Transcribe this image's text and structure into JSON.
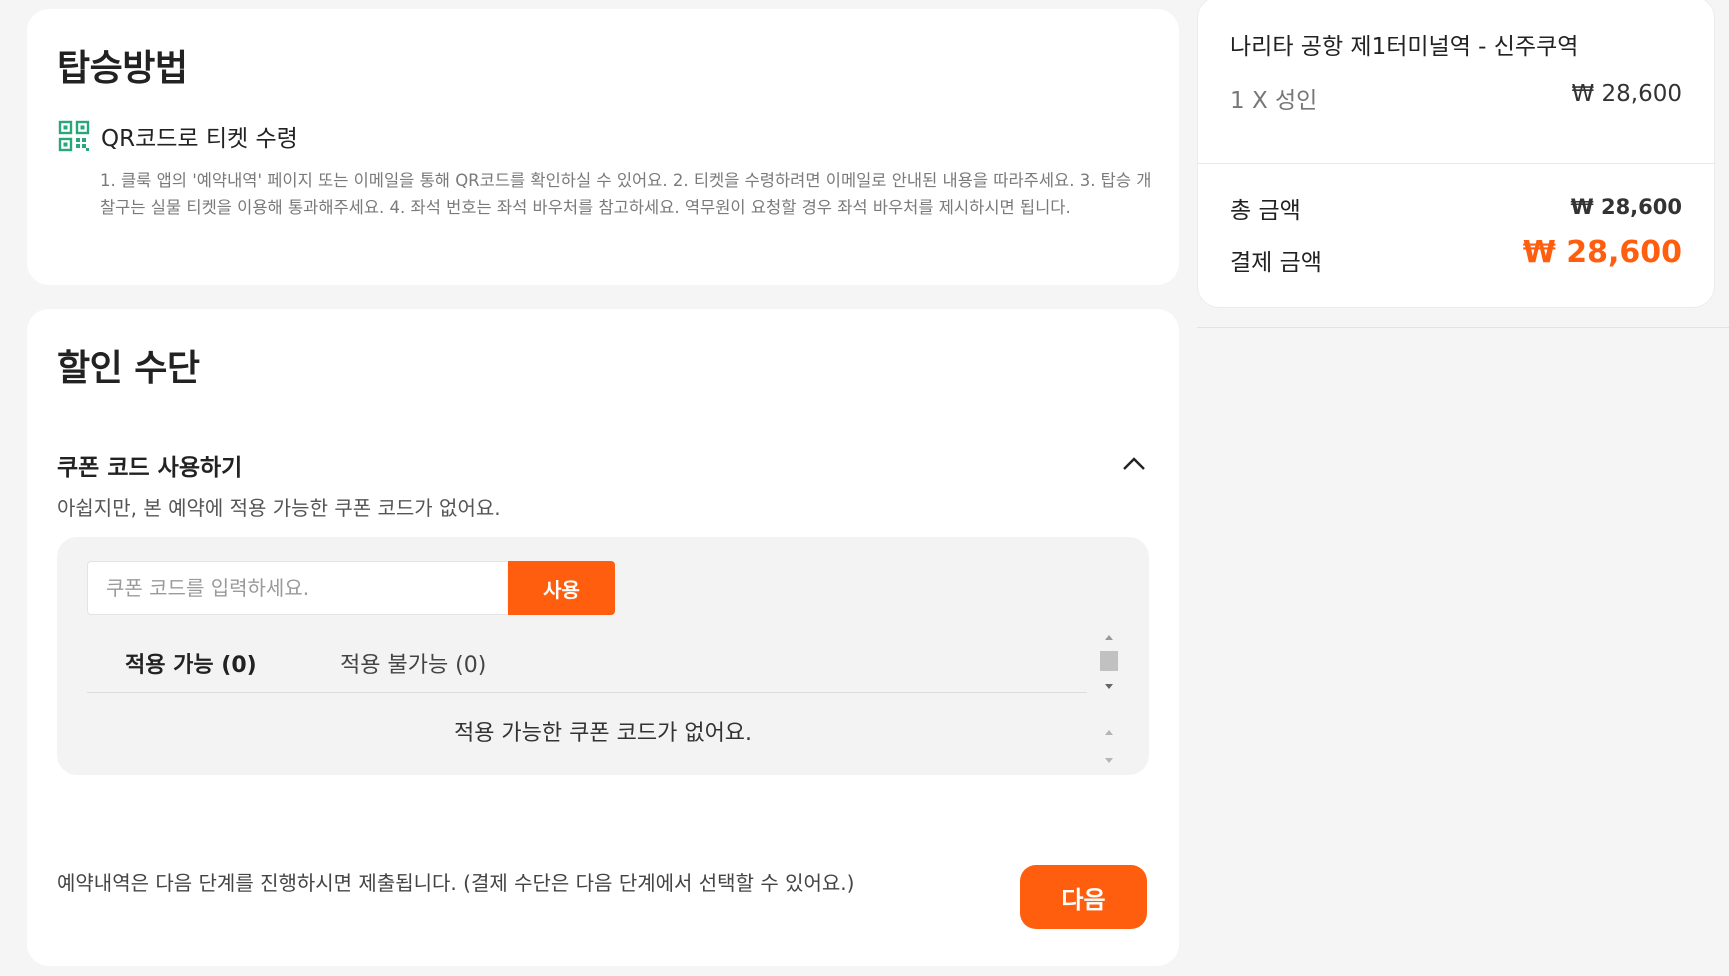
{
  "boarding": {
    "title": "탑승방법",
    "method_icon": "qr-code-icon",
    "method_label": "QR코드로 티켓 수령",
    "guide_text": "1. 클룩 앱의 '예약내역' 페이지 또는 이메일을 통해 QR코드를 확인하실 수 있어요. 2. 티켓을 수령하려면 이메일로 안내된 내용을 따라주세요. 3. 탑승 개찰구는 실물 티켓을 이용해 통과해주세요. 4. 좌석 번호는 좌석 바우처를 참고하세요. 역무원이 요청할 경우 좌석 바우처를 제시하시면 됩니다."
  },
  "discount": {
    "title": "할인 수단",
    "coupon_title": "쿠폰 코드 사용하기",
    "coupon_subtitle": "아쉽지만, 본 예약에 적용 가능한 쿠폰 코드가 없어요.",
    "collapse_icon": "chevron-up-icon",
    "input_placeholder": "쿠폰 코드를 입력하세요.",
    "use_button": "사용",
    "tabs": [
      {
        "label": "적용 가능 (0)"
      },
      {
        "label": "적용 불가능 (0)"
      }
    ],
    "empty_message": "적용 가능한 쿠폰 코드가 없어요."
  },
  "footer": {
    "note": "예약내역은 다음 단계를 진행하시면 제출됩니다. (결제 수단은 다음 단계에서 선택할 수 있어요.)",
    "next_button": "다음"
  },
  "summary": {
    "route": "나리타 공항 제1터미널역 - 신주쿠역",
    "passenger": "1 X 성인",
    "passenger_price": "₩ 28,600",
    "total_label": "총 금액",
    "total_value": "₩ 28,600",
    "pay_label": "결제 금액",
    "pay_value": "₩ 28,600"
  },
  "colors": {
    "accent": "#ff5e0e",
    "qr_icon": "#2aa77a"
  }
}
